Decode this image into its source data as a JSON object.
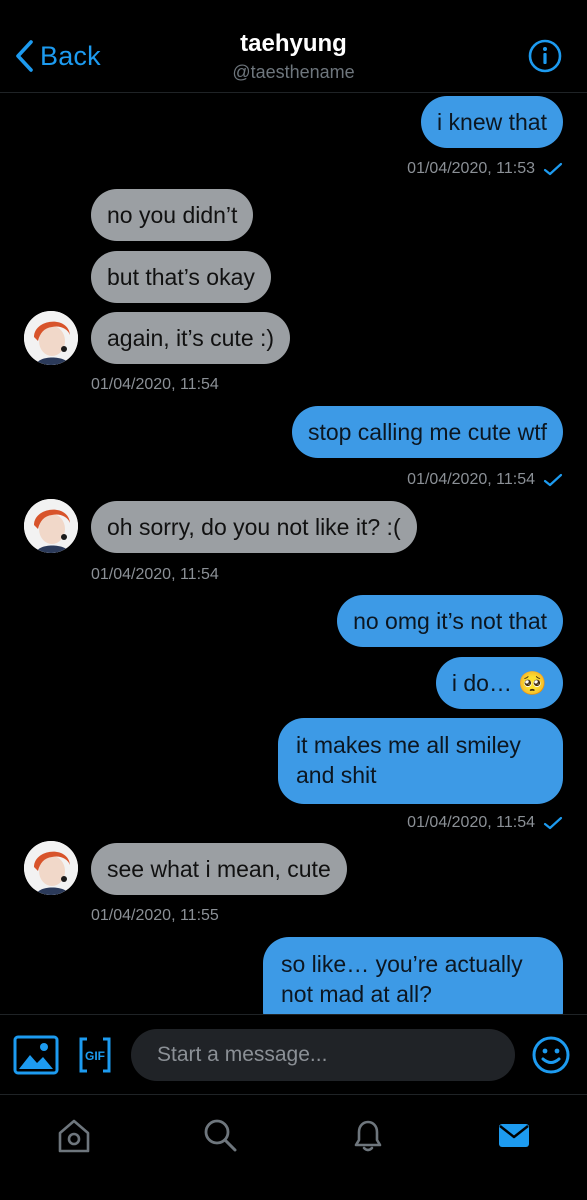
{
  "header": {
    "back_label": "Back",
    "title": "taehyung",
    "handle": "@taesthename"
  },
  "messages": [
    {
      "side": "sent",
      "text": "i knew that"
    },
    {
      "side": "sent-meta",
      "timestamp": "01/04/2020, 11:53",
      "read": true
    },
    {
      "side": "recv",
      "text": "no you didn’t"
    },
    {
      "side": "recv",
      "text": "but that’s okay"
    },
    {
      "side": "recv",
      "text": "again, it’s cute :)"
    },
    {
      "side": "recv-meta",
      "timestamp": "01/04/2020, 11:54"
    },
    {
      "side": "sent",
      "text": "stop calling me cute wtf"
    },
    {
      "side": "sent-meta",
      "timestamp": "01/04/2020, 11:54",
      "read": true
    },
    {
      "side": "recv",
      "text": "oh sorry, do you not like it? :("
    },
    {
      "side": "recv-meta",
      "timestamp": "01/04/2020, 11:54"
    },
    {
      "side": "sent",
      "text": "no omg it’s not that"
    },
    {
      "side": "sent",
      "text": "i do… 🥺"
    },
    {
      "side": "sent",
      "text": "it makes me all smiley and shit"
    },
    {
      "side": "sent-meta",
      "timestamp": "01/04/2020, 11:54",
      "read": true
    },
    {
      "side": "recv",
      "text": "see what i mean, cute"
    },
    {
      "side": "recv-meta",
      "timestamp": "01/04/2020, 11:55"
    },
    {
      "side": "sent",
      "text": "so like… you’re actually not mad at all?"
    }
  ],
  "composer": {
    "placeholder": "Start a message...",
    "gif_label": "GIF"
  },
  "tabs": [
    "home-icon",
    "search-icon",
    "notifications-icon",
    "messages-icon"
  ],
  "colors": {
    "accent": "#1d9bf0",
    "sent_bubble": "#3d9ae6",
    "received_bubble": "#9b9fa3",
    "background": "#000000"
  }
}
